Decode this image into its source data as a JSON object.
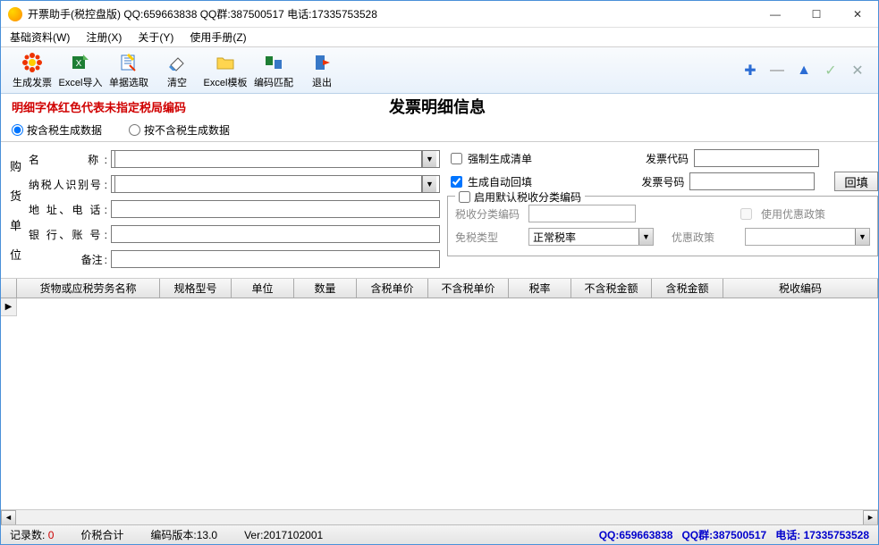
{
  "window": {
    "title": "开票助手(税控盘版)   QQ:659663838   QQ群:387500517  电话:17335753528"
  },
  "menu": {
    "items": [
      "基础资料(W)",
      "注册(X)",
      "关于(Y)",
      "使用手册(Z)"
    ]
  },
  "toolbar": {
    "items": [
      {
        "label": "生成发票",
        "icon": "flower"
      },
      {
        "label": "Excel导入",
        "icon": "excel-in"
      },
      {
        "label": "单据选取",
        "icon": "doc-pick"
      },
      {
        "label": "清空",
        "icon": "eraser"
      },
      {
        "label": "Excel模板",
        "icon": "folder"
      },
      {
        "label": "编码匹配",
        "icon": "match"
      },
      {
        "label": "退出",
        "icon": "exit"
      }
    ],
    "right": [
      "plus",
      "minus",
      "up",
      "check",
      "close"
    ]
  },
  "header": {
    "red_note": "明细字体红色代表未指定税局编码",
    "title": "发票明细信息"
  },
  "radios": {
    "opt1": "按含税生成数据",
    "opt2": "按不含税生成数据"
  },
  "buyer": {
    "side_label": [
      "购",
      "货",
      "单",
      "位"
    ],
    "name_label": "名　　　称",
    "taxid_label": "纳税人识别号",
    "addr_label": "地 址、电 话",
    "bank_label": "银 行、账 号",
    "remark_label": "备注",
    "name": "",
    "taxid": "",
    "addr": "",
    "bank": "",
    "remark": ""
  },
  "options": {
    "force_list": "强制生成清单",
    "auto_fill": "生成自动回填",
    "code_label": "发票代码",
    "num_label": "发票号码",
    "code": "",
    "num": "",
    "backfill_btn": "回填"
  },
  "groupbox": {
    "enable": "启用默认税收分类编码",
    "tax_code_label": "税收分类编码",
    "tax_code": "",
    "use_pref_label": "使用优惠政策",
    "exempt_label": "免税类型",
    "exempt_value": "正常税率",
    "pref_label": "优惠政策",
    "pref_value": ""
  },
  "grid": {
    "columns": [
      "货物或应税劳务名称",
      "规格型号",
      "单位",
      "数量",
      "含税单价",
      "不含税单价",
      "税率",
      "不含税金额",
      "含税金额",
      "税收编码"
    ],
    "widths": [
      160,
      80,
      70,
      70,
      80,
      90,
      70,
      90,
      80,
      100
    ]
  },
  "status": {
    "count_label": "记录数:",
    "count": "0",
    "tax_total_label": "价税合计",
    "ver_label": "编码版本:13.0",
    "ver2": "Ver:2017102001",
    "qq_label": "QQ:",
    "qq": "659663838",
    "qqg_label": "QQ群:",
    "qqg": "387500517",
    "tel_label": "电话:",
    "tel": "17335753528"
  }
}
